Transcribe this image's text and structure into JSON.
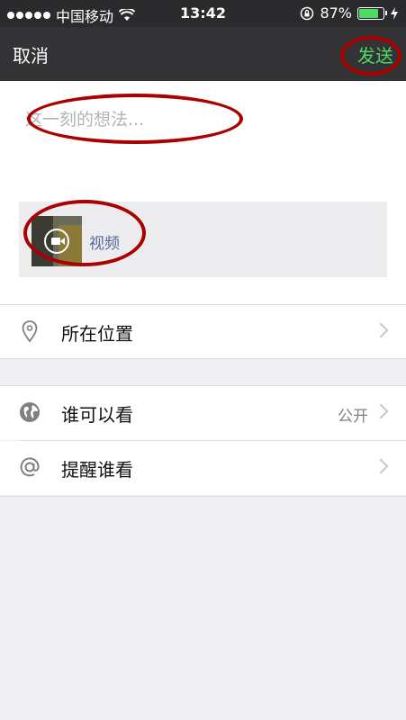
{
  "status_bar": {
    "carrier": "中国移动",
    "time": "13:42",
    "battery": "87%",
    "battery_level": 0.87,
    "battery_color": "#4cd964"
  },
  "nav": {
    "cancel_label": "取消",
    "send_label": "发送",
    "send_color": "#4cd964"
  },
  "compose": {
    "placeholder": "这一刻的想法...",
    "media_label": "视频"
  },
  "cells": {
    "location_label": "所在位置",
    "visibility_label": "谁可以看",
    "visibility_value": "公开",
    "remind_label": "提醒谁看"
  },
  "annotation_color": "#a90000"
}
